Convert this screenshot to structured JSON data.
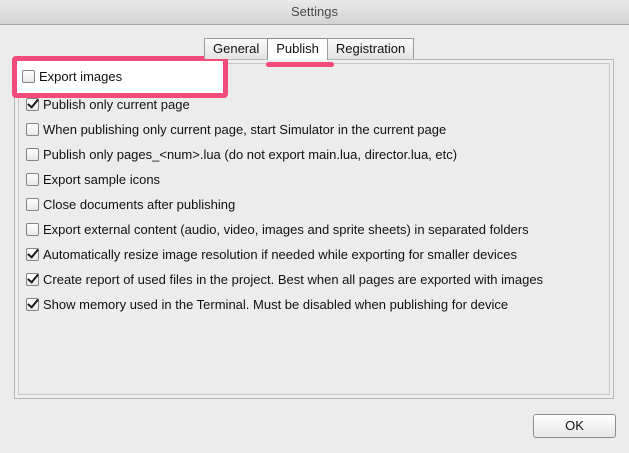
{
  "window": {
    "title": "Settings"
  },
  "tabs": [
    {
      "label": "General",
      "active": false
    },
    {
      "label": "Publish",
      "active": true
    },
    {
      "label": "Registration",
      "active": false
    }
  ],
  "options": [
    {
      "label": "Export images",
      "checked": false
    },
    {
      "label": "Publish only current page",
      "checked": true
    },
    {
      "label": "When publishing only current page, start Simulator in the current page",
      "checked": false
    },
    {
      "label": "Publish only pages_<num>.lua (do not export main.lua, director.lua, etc)",
      "checked": false
    },
    {
      "label": "Export sample icons",
      "checked": false
    },
    {
      "label": "Close documents after publishing",
      "checked": false
    },
    {
      "label": "Export external content (audio, video, images and sprite sheets) in separated folders",
      "checked": false
    },
    {
      "label": "Automatically resize image resolution if needed while exporting for smaller devices",
      "checked": true
    },
    {
      "label": "Create report of used files in the project. Best when all pages are exported with images",
      "checked": true
    },
    {
      "label": "Show memory used in the Terminal. Must be disabled when publishing for device",
      "checked": true
    }
  ],
  "buttons": {
    "ok_label": "OK"
  },
  "colors": {
    "annotation": "#f24a7a"
  }
}
